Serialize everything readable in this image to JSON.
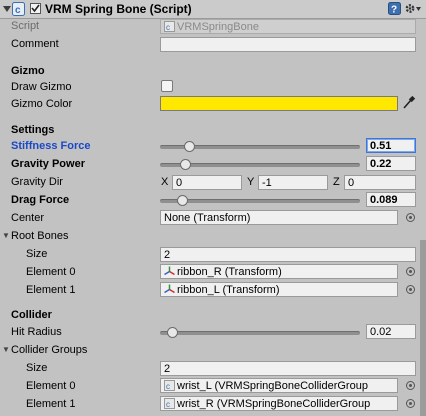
{
  "header": {
    "title": "VRM Spring Bone (Script)",
    "enabled": true
  },
  "script": {
    "label": "Script",
    "value": "VRMSpringBone"
  },
  "comment": {
    "label": "Comment",
    "value": ""
  },
  "gizmo": {
    "section": "Gizmo",
    "draw_label": "Draw Gizmo",
    "draw_checked": false,
    "color_label": "Gizmo Color",
    "color": "#ffe800"
  },
  "settings": {
    "section": "Settings",
    "stiffness": {
      "label": "Stiffness Force",
      "value": "0.51",
      "fraction": 0.13
    },
    "gravity_power": {
      "label": "Gravity Power",
      "value": "0.22",
      "fraction": 0.12
    },
    "gravity_dir": {
      "label": "Gravity Dir",
      "x_label": "X",
      "x": "0",
      "y_label": "Y",
      "y": "-1",
      "z_label": "Z",
      "z": "0"
    },
    "drag": {
      "label": "Drag Force",
      "value": "0.089",
      "fraction": 0.09
    },
    "center": {
      "label": "Center",
      "value": "None (Transform)"
    }
  },
  "root_bones": {
    "label": "Root Bones",
    "size_label": "Size",
    "size": "2",
    "elements": [
      {
        "label": "Element 0",
        "value": "ribbon_R (Transform)"
      },
      {
        "label": "Element 1",
        "value": "ribbon_L (Transform)"
      }
    ]
  },
  "collider": {
    "section": "Collider",
    "hit_radius": {
      "label": "Hit Radius",
      "value": "0.02",
      "fraction": 0.05
    },
    "groups": {
      "label": "Collider Groups",
      "size_label": "Size",
      "size": "2",
      "elements": [
        {
          "label": "Element 0",
          "value": "wrist_L (VRMSpringBoneColliderGroup"
        },
        {
          "label": "Element 1",
          "value": "wrist_R (VRMSpringBoneColliderGroup"
        }
      ]
    }
  },
  "colors": {
    "accent_blue": "#1a49c8",
    "gizmo_yellow": "#ffe800",
    "panel": "#c2c2c2"
  }
}
